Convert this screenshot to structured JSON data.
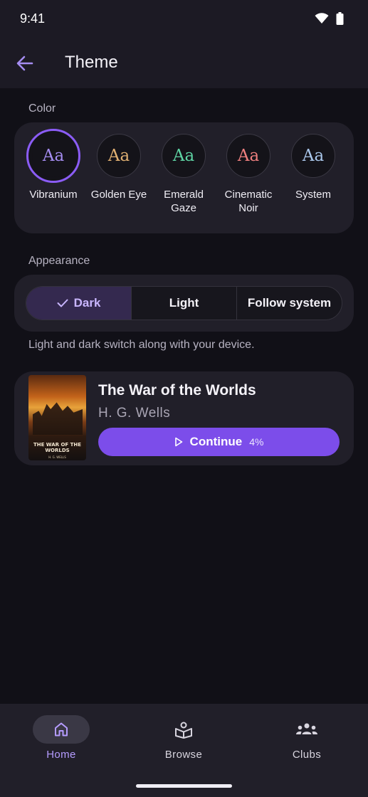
{
  "status": {
    "time": "9:41"
  },
  "header": {
    "title": "Theme"
  },
  "color_section": {
    "label": "Color",
    "swatches": [
      {
        "sample": "Aa",
        "name": "Vibranium",
        "color": "#a48cf0",
        "selected": true
      },
      {
        "sample": "Aa",
        "name": "Golden Eye",
        "color": "#e0b072",
        "selected": false
      },
      {
        "sample": "Aa",
        "name": "Emerald Gaze",
        "color": "#5ed3a3",
        "selected": false
      },
      {
        "sample": "Aa",
        "name": "Cinematic Noir",
        "color": "#ee7f7f",
        "selected": false
      },
      {
        "sample": "Aa",
        "name": "System",
        "color": "#a9c6ea",
        "selected": false
      }
    ]
  },
  "appearance_section": {
    "label": "Appearance",
    "options": [
      {
        "label": "Dark",
        "active": true
      },
      {
        "label": "Light",
        "active": false
      },
      {
        "label": "Follow system",
        "active": false
      }
    ],
    "hint": "Light and dark switch along with your device."
  },
  "book": {
    "title": "The War of the Worlds",
    "author": "H. G. Wells",
    "cover_title": "THE WAR OF THE WORLDS",
    "cover_author": "H. G. WELLS",
    "continue_label": "Continue",
    "progress_label": "4%",
    "progress": 0.04
  },
  "bottom_nav": {
    "items": [
      {
        "label": "Home",
        "icon": "home-icon",
        "active": true
      },
      {
        "label": "Browse",
        "icon": "book-browse-icon",
        "active": false
      },
      {
        "label": "Clubs",
        "icon": "groups-icon",
        "active": false
      }
    ]
  },
  "colors": {
    "accent": "#7c4dea",
    "background": "#111017",
    "surface": "#211f29"
  }
}
